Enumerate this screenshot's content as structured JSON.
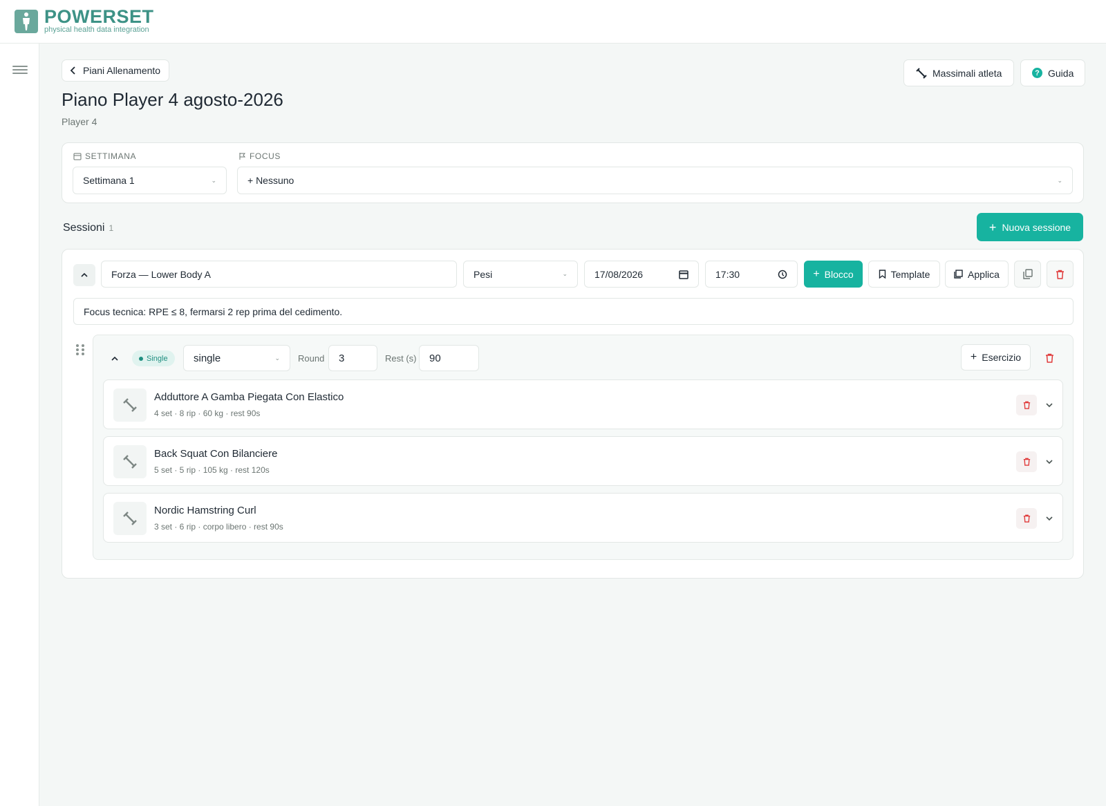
{
  "brand": {
    "name": "POWERSET",
    "tagline": "physical health data integration",
    "accent": "#17b3a0"
  },
  "nav": {
    "back_label": "Piani Allenamento",
    "max_label": "Massimali atleta",
    "guide_label": "Guida",
    "guide_icon_glyph": "?"
  },
  "page": {
    "title": "Piano Player 4 agosto-2026",
    "subtitle": "Player 4"
  },
  "filters": {
    "week": {
      "label": "SETTIMANA",
      "value": "Settimana 1"
    },
    "focus": {
      "label": "FOCUS",
      "value": "+ Nessuno"
    }
  },
  "sessions": {
    "heading": "Sessioni",
    "count": "1",
    "new_label": "Nuova sessione"
  },
  "session": {
    "name": "Forza — Lower Body A",
    "type": "Pesi",
    "date": "17/08/2026",
    "time": "17:30",
    "add_block_label": "Blocco",
    "template_label": "Template",
    "apply_label": "Applica",
    "notes": "Focus tecnica: RPE ≤ 8, fermarsi 2 rep prima del cedimento."
  },
  "block": {
    "badge": "Single",
    "kind": "single",
    "round_label": "Round",
    "round_value": "3",
    "rest_label": "Rest (s)",
    "rest_value": "90",
    "add_exercise_label": "Esercizio"
  },
  "exercises": [
    {
      "name": "Adduttore A Gamba Piegata Con Elastico",
      "detail": "4 set · 8 rip · 60 kg · rest 90s"
    },
    {
      "name": "Back Squat Con Bilanciere",
      "detail": "5 set · 5 rip · 105 kg · rest 120s"
    },
    {
      "name": "Nordic Hamstring Curl",
      "detail": "3 set · 6 rip · corpo libero · rest 90s"
    }
  ]
}
